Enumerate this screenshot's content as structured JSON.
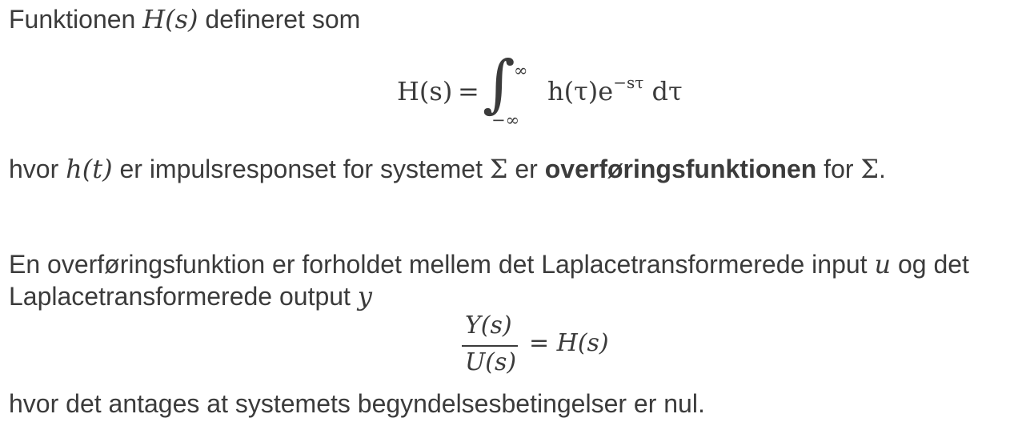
{
  "p1": {
    "pre": "Funktionen ",
    "math": "H(s)",
    "post": " defineret som"
  },
  "eq1": {
    "lhs": "H(s)",
    "equals": "=",
    "integral": "∫",
    "upper": "∞",
    "lower": "−∞",
    "integrand": "h(τ)e",
    "exponent": "−sτ",
    "differential": " dτ"
  },
  "p2": {
    "pre": "hvor ",
    "math1": "h(t)",
    "mid1": " er impulsresponset for systemet ",
    "sym1": "Σ",
    "mid2": " er ",
    "bold": "overføringsfunktionen",
    "mid3": " for ",
    "sym2": "Σ",
    "post": "."
  },
  "p3": {
    "line1_pre": "En overføringsfunktion er forholdet mellem det Laplacetransformerede input ",
    "math_u": "u",
    "line1_post": " og det",
    "line2_pre": "Laplacetransformerede output ",
    "math_y": "y"
  },
  "eq2": {
    "numerator": "Y(s)",
    "denominator": "U(s)",
    "rhs": "= H(s)"
  },
  "p4": {
    "text": "hvor det antages at systemets begyndelsesbetingelser er nul."
  }
}
